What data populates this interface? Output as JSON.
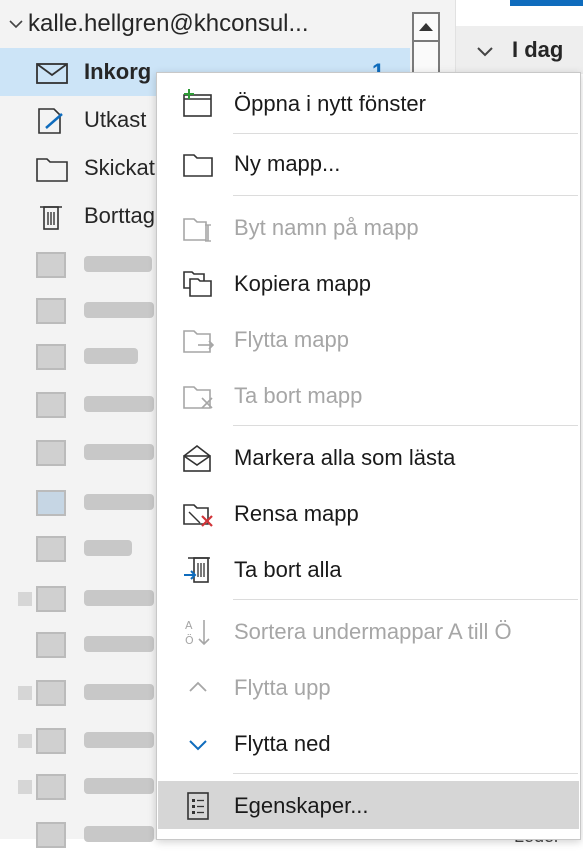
{
  "account": {
    "name": "kalle.hellgren@khconsul..."
  },
  "folders": [
    {
      "label": "Inkorg",
      "count": "1",
      "selected": true,
      "icon": "mail-icon"
    },
    {
      "label": "Utkast",
      "icon": "draft-icon"
    },
    {
      "label": "Skickat",
      "icon": "folder-icon"
    },
    {
      "label": "Borttag",
      "icon": "trash-icon"
    }
  ],
  "message_list": {
    "group_label": "I dag",
    "bottom_text": "Ledel"
  },
  "context_menu": {
    "items": [
      {
        "label": "Öppna i nytt fönster",
        "icon": "new-window-icon",
        "enabled": true
      },
      {
        "label": "Ny mapp...",
        "icon": "new-folder-icon",
        "enabled": true
      },
      {
        "label": "Byt namn på mapp",
        "icon": "rename-folder-icon",
        "enabled": false
      },
      {
        "label": "Kopiera mapp",
        "icon": "copy-folder-icon",
        "enabled": true
      },
      {
        "label": "Flytta mapp",
        "icon": "move-folder-icon",
        "enabled": false
      },
      {
        "label": "Ta bort mapp",
        "icon": "delete-folder-icon",
        "enabled": false
      },
      {
        "label": "Markera alla som lästa",
        "icon": "mark-read-icon",
        "enabled": true
      },
      {
        "label": "Rensa mapp",
        "icon": "clean-folder-icon",
        "enabled": true
      },
      {
        "label": "Ta bort alla",
        "icon": "delete-all-icon",
        "enabled": true
      },
      {
        "label": "Sortera undermappar A till Ö",
        "icon": "sort-az-icon",
        "enabled": false
      },
      {
        "label": "Flytta upp",
        "icon": "move-up-icon",
        "enabled": false
      },
      {
        "label": "Flytta ned",
        "icon": "move-down-icon",
        "enabled": true
      },
      {
        "label": "Egenskaper...",
        "icon": "properties-icon",
        "enabled": true
      }
    ]
  },
  "colors": {
    "accent": "#0f6cbd",
    "selected_row": "#cce4f7",
    "hover_item": "#d6d6d6",
    "delete_red": "#d13438"
  }
}
